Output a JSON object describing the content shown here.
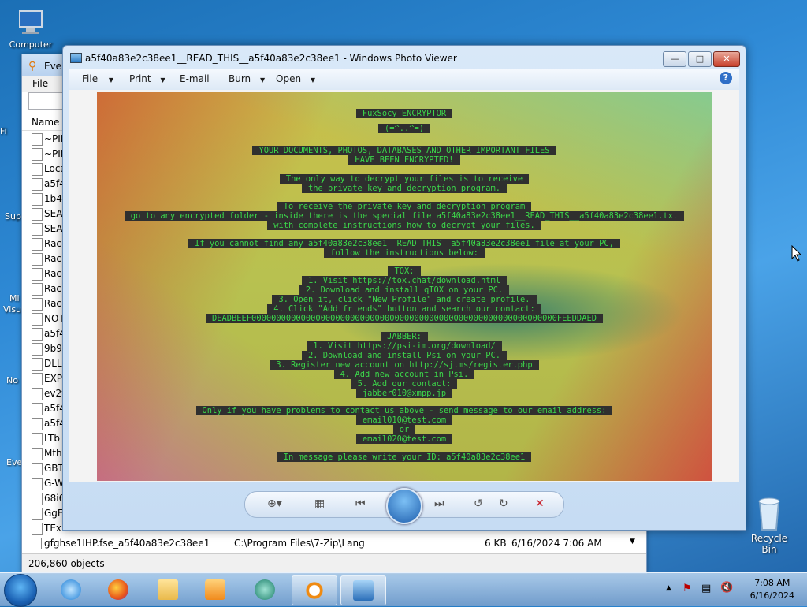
{
  "desktop": {
    "icons": [
      {
        "label": "Computer",
        "icon": "computer-icon"
      },
      {
        "label": "Recycle Bin",
        "icon": "recycle-bin-icon"
      }
    ],
    "partial_labels": [
      "Fi",
      "Sup",
      "Mi",
      "Visu",
      "No",
      "Eve"
    ]
  },
  "everything": {
    "title": "Eve",
    "menu": [
      "File"
    ],
    "column_name": "Name",
    "rows": [
      "~PIF",
      "~PIF",
      "Loca",
      "a5f4",
      "1b4e",
      "SEA",
      "SEA",
      "Rac",
      "Rac",
      "Rac",
      "Rac",
      "Rac",
      "NOT",
      "a5f4",
      "9b9",
      "DLL",
      "EXP",
      "ev2v",
      "a5f4",
      "a5f4",
      "LTb",
      "Mth",
      "GBT",
      "G-W",
      "68i6",
      "GgE",
      "TEx"
    ],
    "last_row": {
      "name": "gfghse1IHP.fse_a5f40a83e2c38ee1",
      "path": "C:\\Program Files\\7-Zip\\Lang",
      "size": "6 KB",
      "modified": "6/16/2024 7:06 AM"
    },
    "status": "206,860 objects"
  },
  "viewer": {
    "title": "a5f40a83e2c38ee1__READ_THIS__a5f40a83e2c38ee1 - Windows Photo Viewer",
    "toolbar": {
      "file": "File",
      "print": "Print",
      "email": "E-mail",
      "burn": "Burn",
      "open": "Open"
    },
    "note_lines": [
      "FuxSocy ENCRYPTOR",
      "(=^..^=)",
      "YOUR DOCUMENTS, PHOTOS, DATABASES AND OTHER IMPORTANT FILES",
      "HAVE BEEN ENCRYPTED!",
      "The only way to decrypt your files is to receive",
      "the private key and decryption program.",
      "To receive the private key and decryption program",
      "go to any encrypted folder - inside there is the special file a5f40a83e2c38ee1__READ_THIS__a5f40a83e2c38ee1.txt",
      "with complete instructions how to decrypt your files.",
      "If you cannot find any a5f40a83e2c38ee1__READ_THIS__a5f40a83e2c38ee1 file at your PC,",
      "follow the instructions below:",
      "TOX:",
      "1. Visit https://tox.chat/download.html",
      "2. Download and install qTOX on your PC.",
      "3. Open it, click \"New Profile\" and create profile.",
      "4. Click \"Add friends\" button and search our contact:",
      "DEADBEEF00000000000000000000000000000000000000000000000000000000000000FEEDDAED",
      "JABBER:",
      "1. Visit https://psi-im.org/download/",
      "2. Download and install Psi on your PC.",
      "3. Register new account on http://sj.ms/register.php",
      "4. Add new account in Psi.",
      "5. Add our contact:",
      "jabber010@xmpp.jp",
      "Only if you have problems to contact us above - send message to our email address:",
      "email010@test.com",
      "or",
      "email020@test.com",
      "In message please write your ID: a5f40a83e2c38ee1"
    ]
  },
  "taskbar": {
    "clock_time": "7:08 AM",
    "clock_date": "6/16/2024"
  }
}
